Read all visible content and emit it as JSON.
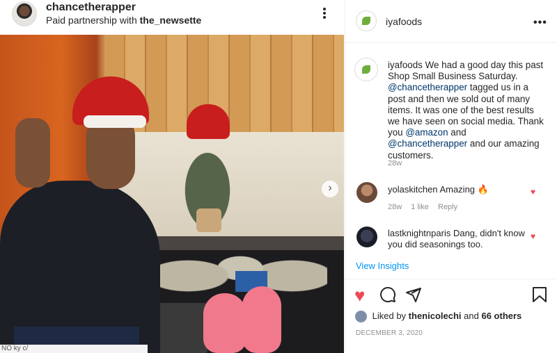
{
  "post": {
    "author": "chancetherapper",
    "partnership_prefix": "Paid partnership with",
    "partner": "the_newsette",
    "url_strip": "NO ky c/"
  },
  "panel": {
    "account": "iyafoods",
    "caption": {
      "user": "iyafoods",
      "part1": "We had a good day this past Shop Small Business Saturday.",
      "mention1": "@chancetherapper",
      "part2": "tagged us in a post and then we sold out of many items. It was one of the best results we have seen on social media. Thank you",
      "mention2": "@amazon",
      "part3": "and",
      "mention3": "@chancetherapper",
      "part4": "and our amazing customers.",
      "time": "28w"
    },
    "comments": [
      {
        "user": "yolaskitchen",
        "text": "Amazing 🔥",
        "time": "28w",
        "likes": "1 like",
        "reply": "Reply"
      },
      {
        "user": "lastknightnparis",
        "text": "Dang, didn't know you did seasonings too."
      }
    ],
    "view_insights": "View Insights",
    "liked_by_prefix": "Liked by",
    "liked_by_user": "thenicolechi",
    "liked_by_mid": "and",
    "liked_by_others": "66 others",
    "date": "DECEMBER 3, 2020",
    "colors": {
      "like": "#ed4956",
      "link": "#0095f6",
      "mention": "#00376b"
    }
  },
  "icons": [
    "kebab-menu-icon",
    "more-icon",
    "next-arrow-icon",
    "heart-icon",
    "comment-icon",
    "share-icon",
    "bookmark-icon"
  ]
}
